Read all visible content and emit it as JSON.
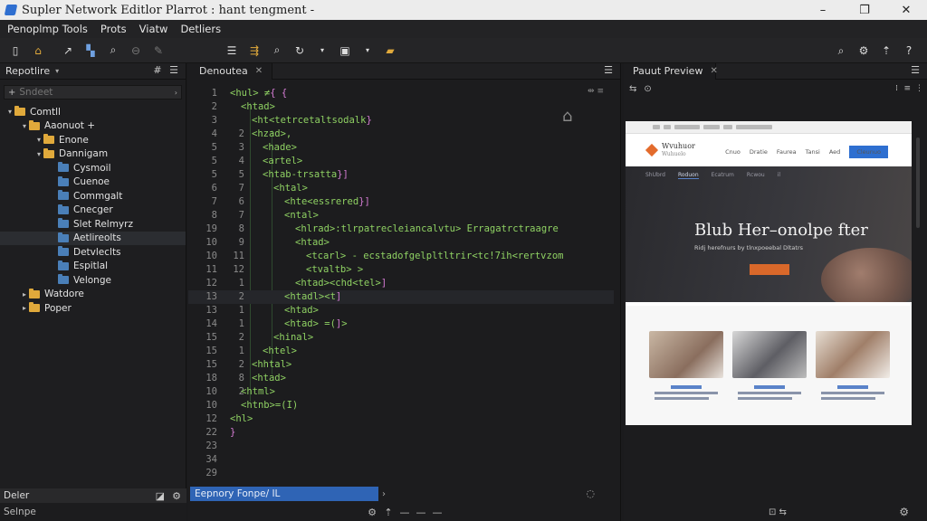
{
  "window": {
    "title": "Supler Network Editlor Plarrot : hant tengment -",
    "controls": [
      "–",
      "❐",
      "✕"
    ]
  },
  "menu": [
    "Penoplmp Tools",
    "Prots",
    "Viatw",
    "Detliers"
  ],
  "left_panel": {
    "title": "Repotlire",
    "search_placeholder": "Sndeet",
    "tree": [
      {
        "label": "Comtll",
        "depth": 0,
        "arrow": "▾",
        "icon": "folder-icon"
      },
      {
        "label": "Aaonuot +",
        "depth": 1,
        "arrow": "▾",
        "icon": "folder-icon"
      },
      {
        "label": "Enone",
        "depth": 2,
        "arrow": "▾",
        "icon": "folder-icon"
      },
      {
        "label": "Dannigam",
        "depth": 2,
        "arrow": "▾",
        "icon": "folder-icon"
      },
      {
        "label": "Cysmoil",
        "depth": 3,
        "arrow": "",
        "icon": "folder-icon"
      },
      {
        "label": "Cuenoe",
        "depth": 3,
        "arrow": "",
        "icon": "folder-icon"
      },
      {
        "label": "Commgalt",
        "depth": 3,
        "arrow": "",
        "icon": "folder-icon"
      },
      {
        "label": "Cnecger",
        "depth": 3,
        "arrow": "",
        "icon": "folder-icon"
      },
      {
        "label": "Slet Relmyrz",
        "depth": 3,
        "arrow": "",
        "icon": "file-icon"
      },
      {
        "label": "Aetlireolts",
        "depth": 3,
        "arrow": "",
        "icon": "folder-icon"
      },
      {
        "label": "Detvleclts",
        "depth": 3,
        "arrow": "",
        "icon": "folder-icon"
      },
      {
        "label": "Espitlal",
        "depth": 3,
        "arrow": "",
        "icon": "folder-icon"
      },
      {
        "label": "Velonge",
        "depth": 3,
        "arrow": "",
        "icon": "folder-icon"
      },
      {
        "label": "Watdore",
        "depth": 1,
        "arrow": "▸",
        "icon": "folder-icon"
      },
      {
        "label": "Poper",
        "depth": 1,
        "arrow": "▸",
        "icon": "folder-icon"
      }
    ],
    "footer_label": "Deler",
    "footer2_label": "Selnpe"
  },
  "editor": {
    "tab_label": "Denoutea",
    "status_text": "Eepnory Fonpe/ IL",
    "lines": [
      {
        "n1": "1",
        "n2": "",
        "indent": 0,
        "text": "<hul> ≠{  {",
        "hl": false
      },
      {
        "n1": "2",
        "n2": "",
        "indent": 1,
        "text": "<htad>",
        "hl": false
      },
      {
        "n1": "3",
        "n2": "",
        "indent": 2,
        "text": "<ht<tetrcetaltsodalk}",
        "hl": false
      },
      {
        "n1": "4",
        "n2": "2",
        "indent": 2,
        "text": "<hzad>,",
        "hl": false
      },
      {
        "n1": "5",
        "n2": "3",
        "indent": 3,
        "text": "<hade>",
        "hl": false
      },
      {
        "n1": "5",
        "n2": "4",
        "indent": 3,
        "text": "<artel>",
        "hl": false
      },
      {
        "n1": "5",
        "n2": "5",
        "indent": 3,
        "text": "<htab-trsatta}]",
        "hl": false
      },
      {
        "n1": "6",
        "n2": "7",
        "indent": 4,
        "text": "<htal>",
        "hl": false
      },
      {
        "n1": "7",
        "n2": "6",
        "indent": 5,
        "text": "<hte<essrered}]",
        "hl": false
      },
      {
        "n1": "8",
        "n2": "7",
        "indent": 5,
        "text": "<ntal>",
        "hl": false
      },
      {
        "n1": "19",
        "n2": "8",
        "indent": 6,
        "text": "<hlrad>:tlrpatrecleiancalvtu> Erragatrctraagre",
        "hl": false
      },
      {
        "n1": "10",
        "n2": "9",
        "indent": 6,
        "text": "<htad>",
        "hl": false
      },
      {
        "n1": "10",
        "n2": "11",
        "indent": 7,
        "text": "<tcarl> - ecstadofgelpltltrir<tc!7ih<rertvzom",
        "hl": false
      },
      {
        "n1": "11",
        "n2": "12",
        "indent": 7,
        "text": "<tvaltb> >",
        "hl": false
      },
      {
        "n1": "12",
        "n2": "1",
        "indent": 6,
        "text": "<htad><chd<tel>]",
        "hl": false
      },
      {
        "n1": "13",
        "n2": "2",
        "indent": 5,
        "text": "<htadl><t]",
        "hl": true
      },
      {
        "n1": "13",
        "n2": "1",
        "indent": 5,
        "text": "<htad>",
        "hl": false
      },
      {
        "n1": "14",
        "n2": "1",
        "indent": 5,
        "text": "<htad> =(]>",
        "hl": false
      },
      {
        "n1": "15",
        "n2": "2",
        "indent": 4,
        "text": "<hinal>",
        "hl": false
      },
      {
        "n1": "15",
        "n2": "1",
        "indent": 3,
        "text": "<htel>",
        "hl": false
      },
      {
        "n1": "15",
        "n2": "2",
        "indent": 2,
        "text": "<hhtal>",
        "hl": false
      },
      {
        "n1": "18",
        "n2": "8",
        "indent": 2,
        "text": "<htad>",
        "hl": false
      },
      {
        "n1": "10",
        "n2": "2",
        "indent": 1,
        "text": "<html>",
        "hl": false
      },
      {
        "n1": "10",
        "n2": "",
        "indent": 1,
        "text": "<htnb>=(I)",
        "hl": false
      },
      {
        "n1": "12",
        "n2": "",
        "indent": 0,
        "text": "<hl>",
        "hl": false
      },
      {
        "n1": "22",
        "n2": "",
        "indent": 0,
        "text": "}",
        "hl": false
      },
      {
        "n1": "23",
        "n2": "",
        "indent": 0,
        "text": "",
        "hl": false
      },
      {
        "n1": "34",
        "n2": "",
        "indent": 0,
        "text": "",
        "hl": false
      },
      {
        "n1": "29",
        "n2": "",
        "indent": 0,
        "text": "",
        "hl": false
      }
    ]
  },
  "preview": {
    "tab_label": "Pauut Preview",
    "logo_text": "Wvuhuor",
    "logo_sub": "Wuhuelo",
    "nav_links": [
      "Cnuo",
      "Dratie",
      "Faurea",
      "Tansi",
      "Aed"
    ],
    "nav_cta": "Cleunuo",
    "subnav": [
      "ShUbrd",
      "Roduon",
      "Ecatrum",
      "Rcwou",
      "il"
    ],
    "hero_title": "Blub Her–onolpe fter",
    "hero_sub": "Ridj herefnurs by tlnxpoeebal Dltatrs"
  },
  "colors": {
    "accent_blue": "#2f64b5",
    "folder_yellow": "#e0a93b",
    "tag_green": "#8fd163",
    "attr_purple": "#d77dd6"
  }
}
